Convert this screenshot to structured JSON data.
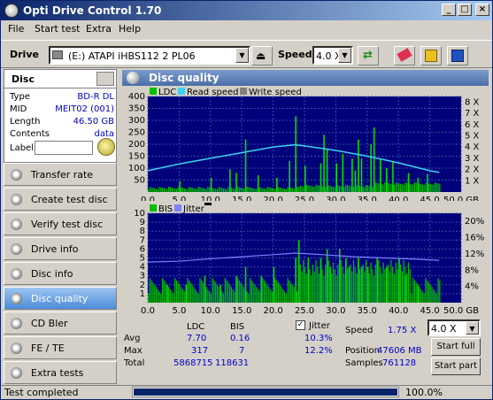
{
  "window": {
    "title": "Opti Drive Control 1.70"
  },
  "menu": [
    "File",
    "Start test",
    "Extra",
    "Help"
  ],
  "toolbar": {
    "drive_label": "Drive",
    "drive_value": "(E:)   ATAPI iHBS112   2 PL06",
    "speed_label": "Speed",
    "speed_value": "4.0 X"
  },
  "disc": {
    "header": "Disc",
    "type_label": "Type",
    "type_value": "BD-R DL",
    "mid_label": "MID",
    "mid_value": "MEIT02 (001)",
    "length_label": "Length",
    "length_value": "46.50 GB",
    "contents_label": "Contents",
    "contents_value": "data",
    "label_label": "Label"
  },
  "nav": [
    "Transfer rate",
    "Create test disc",
    "Verify test disc",
    "Drive info",
    "Disc info",
    "Disc quality",
    "CD Bler",
    "FE / TE",
    "Extra tests"
  ],
  "main_title": "Disc quality",
  "chart_data": [
    {
      "type": "bar",
      "legend": [
        "LDC",
        "Read speed",
        "Write speed"
      ],
      "x_ticks": [
        "0.0",
        "5.0",
        "10.0",
        "15.0",
        "20.0",
        "25.0",
        "30.0",
        "35.0",
        "40.0",
        "45.0",
        "50.0 GB"
      ],
      "y_left_ticks": [
        "400",
        "350",
        "300",
        "250",
        "200",
        "150",
        "100",
        "50"
      ],
      "y_right_ticks": [
        "8 X",
        "7 X",
        "6 X",
        "5 X",
        "4 X",
        "3 X",
        "2 X",
        "1 X"
      ],
      "xlim": [
        0,
        50
      ],
      "ylim": [
        0,
        400
      ],
      "ldc_spikes": [
        [
          5,
          45
        ],
        [
          10,
          60
        ],
        [
          13,
          95
        ],
        [
          14,
          80
        ],
        [
          15.5,
          220
        ],
        [
          17.5,
          70
        ],
        [
          20.5,
          60
        ],
        [
          22.5,
          130
        ],
        [
          23.5,
          317
        ],
        [
          25,
          110
        ],
        [
          27.5,
          120
        ],
        [
          28,
          240
        ],
        [
          28.5,
          180
        ],
        [
          30,
          120
        ],
        [
          31,
          160
        ],
        [
          32.5,
          140
        ],
        [
          33,
          90
        ],
        [
          33.5,
          220
        ],
        [
          34,
          140
        ],
        [
          35.5,
          200
        ],
        [
          36,
          270
        ],
        [
          37,
          140
        ],
        [
          38,
          100
        ],
        [
          39,
          130
        ],
        [
          41.5,
          80
        ],
        [
          43,
          60
        ],
        [
          44.5,
          75
        ]
      ],
      "read_speed": [
        [
          0,
          1.9
        ],
        [
          5,
          2.5
        ],
        [
          10,
          3.0
        ],
        [
          15,
          3.5
        ],
        [
          20,
          4.0
        ],
        [
          23.5,
          4.2
        ],
        [
          25,
          4.1
        ],
        [
          30,
          3.7
        ],
        [
          35,
          3.2
        ],
        [
          40,
          2.6
        ],
        [
          45,
          1.9
        ],
        [
          46.5,
          1.75
        ]
      ]
    },
    {
      "type": "bar",
      "legend": [
        "BIS",
        "Jitter"
      ],
      "x_ticks": [
        "0.0",
        "5.0",
        "10.0",
        "15.0",
        "20.0",
        "25.0",
        "30.0",
        "35.0",
        "40.0",
        "45.0",
        "50.0 GB"
      ],
      "y_left_ticks": [
        "10",
        "9",
        "8",
        "7",
        "6",
        "5",
        "4",
        "3",
        "2",
        "1"
      ],
      "y_right_ticks": [
        "20%",
        "16%",
        "12%",
        "8%",
        "4%"
      ],
      "xlim": [
        0,
        50
      ],
      "ylim": [
        0,
        10
      ],
      "bis_spikes": [
        [
          3,
          2
        ],
        [
          6,
          2
        ],
        [
          9,
          3
        ],
        [
          11.5,
          2
        ],
        [
          14,
          3
        ],
        [
          15.5,
          4
        ],
        [
          18,
          3
        ],
        [
          20,
          4
        ],
        [
          23.5,
          5
        ],
        [
          24,
          7
        ],
        [
          25.5,
          5
        ],
        [
          27.5,
          5
        ],
        [
          28.5,
          6
        ],
        [
          29,
          4
        ],
        [
          30.5,
          6
        ],
        [
          31.5,
          5
        ],
        [
          32,
          4
        ],
        [
          33.5,
          5
        ],
        [
          34,
          4
        ],
        [
          35,
          4
        ],
        [
          36.5,
          5
        ],
        [
          38,
          4
        ],
        [
          40,
          5
        ],
        [
          41,
          3
        ],
        [
          43,
          2
        ]
      ],
      "jitter": [
        [
          0,
          10.0
        ],
        [
          5,
          10.2
        ],
        [
          10,
          10.8
        ],
        [
          15,
          11.3
        ],
        [
          20,
          11.8
        ],
        [
          23.5,
          12.2
        ],
        [
          28,
          11.8
        ],
        [
          33,
          11.3
        ],
        [
          38,
          11.0
        ],
        [
          43,
          10.7
        ],
        [
          46.5,
          10.4
        ]
      ]
    }
  ],
  "stats": {
    "col_ldc": "LDC",
    "col_bis": "BIS",
    "avg_label": "Avg",
    "avg_ldc": "7.70",
    "avg_bis": "0.16",
    "max_label": "Max",
    "max_ldc": "317",
    "max_bis": "7",
    "total_label": "Total",
    "total_ldc": "5868715",
    "total_bis": "118631",
    "jitter_label": "Jitter",
    "jitter_avg": "10.3%",
    "jitter_max": "12.2%",
    "speed_label": "Speed",
    "speed_value": "1.75 X",
    "speed_select": "4.0 X",
    "position_label": "Position",
    "position_value": "47606 MB",
    "samples_label": "Samples",
    "samples_value": "761128",
    "start_full": "Start full",
    "start_part": "Start part"
  },
  "status": {
    "text": "Test completed",
    "progress": 1.0,
    "percent": "100.0%"
  }
}
